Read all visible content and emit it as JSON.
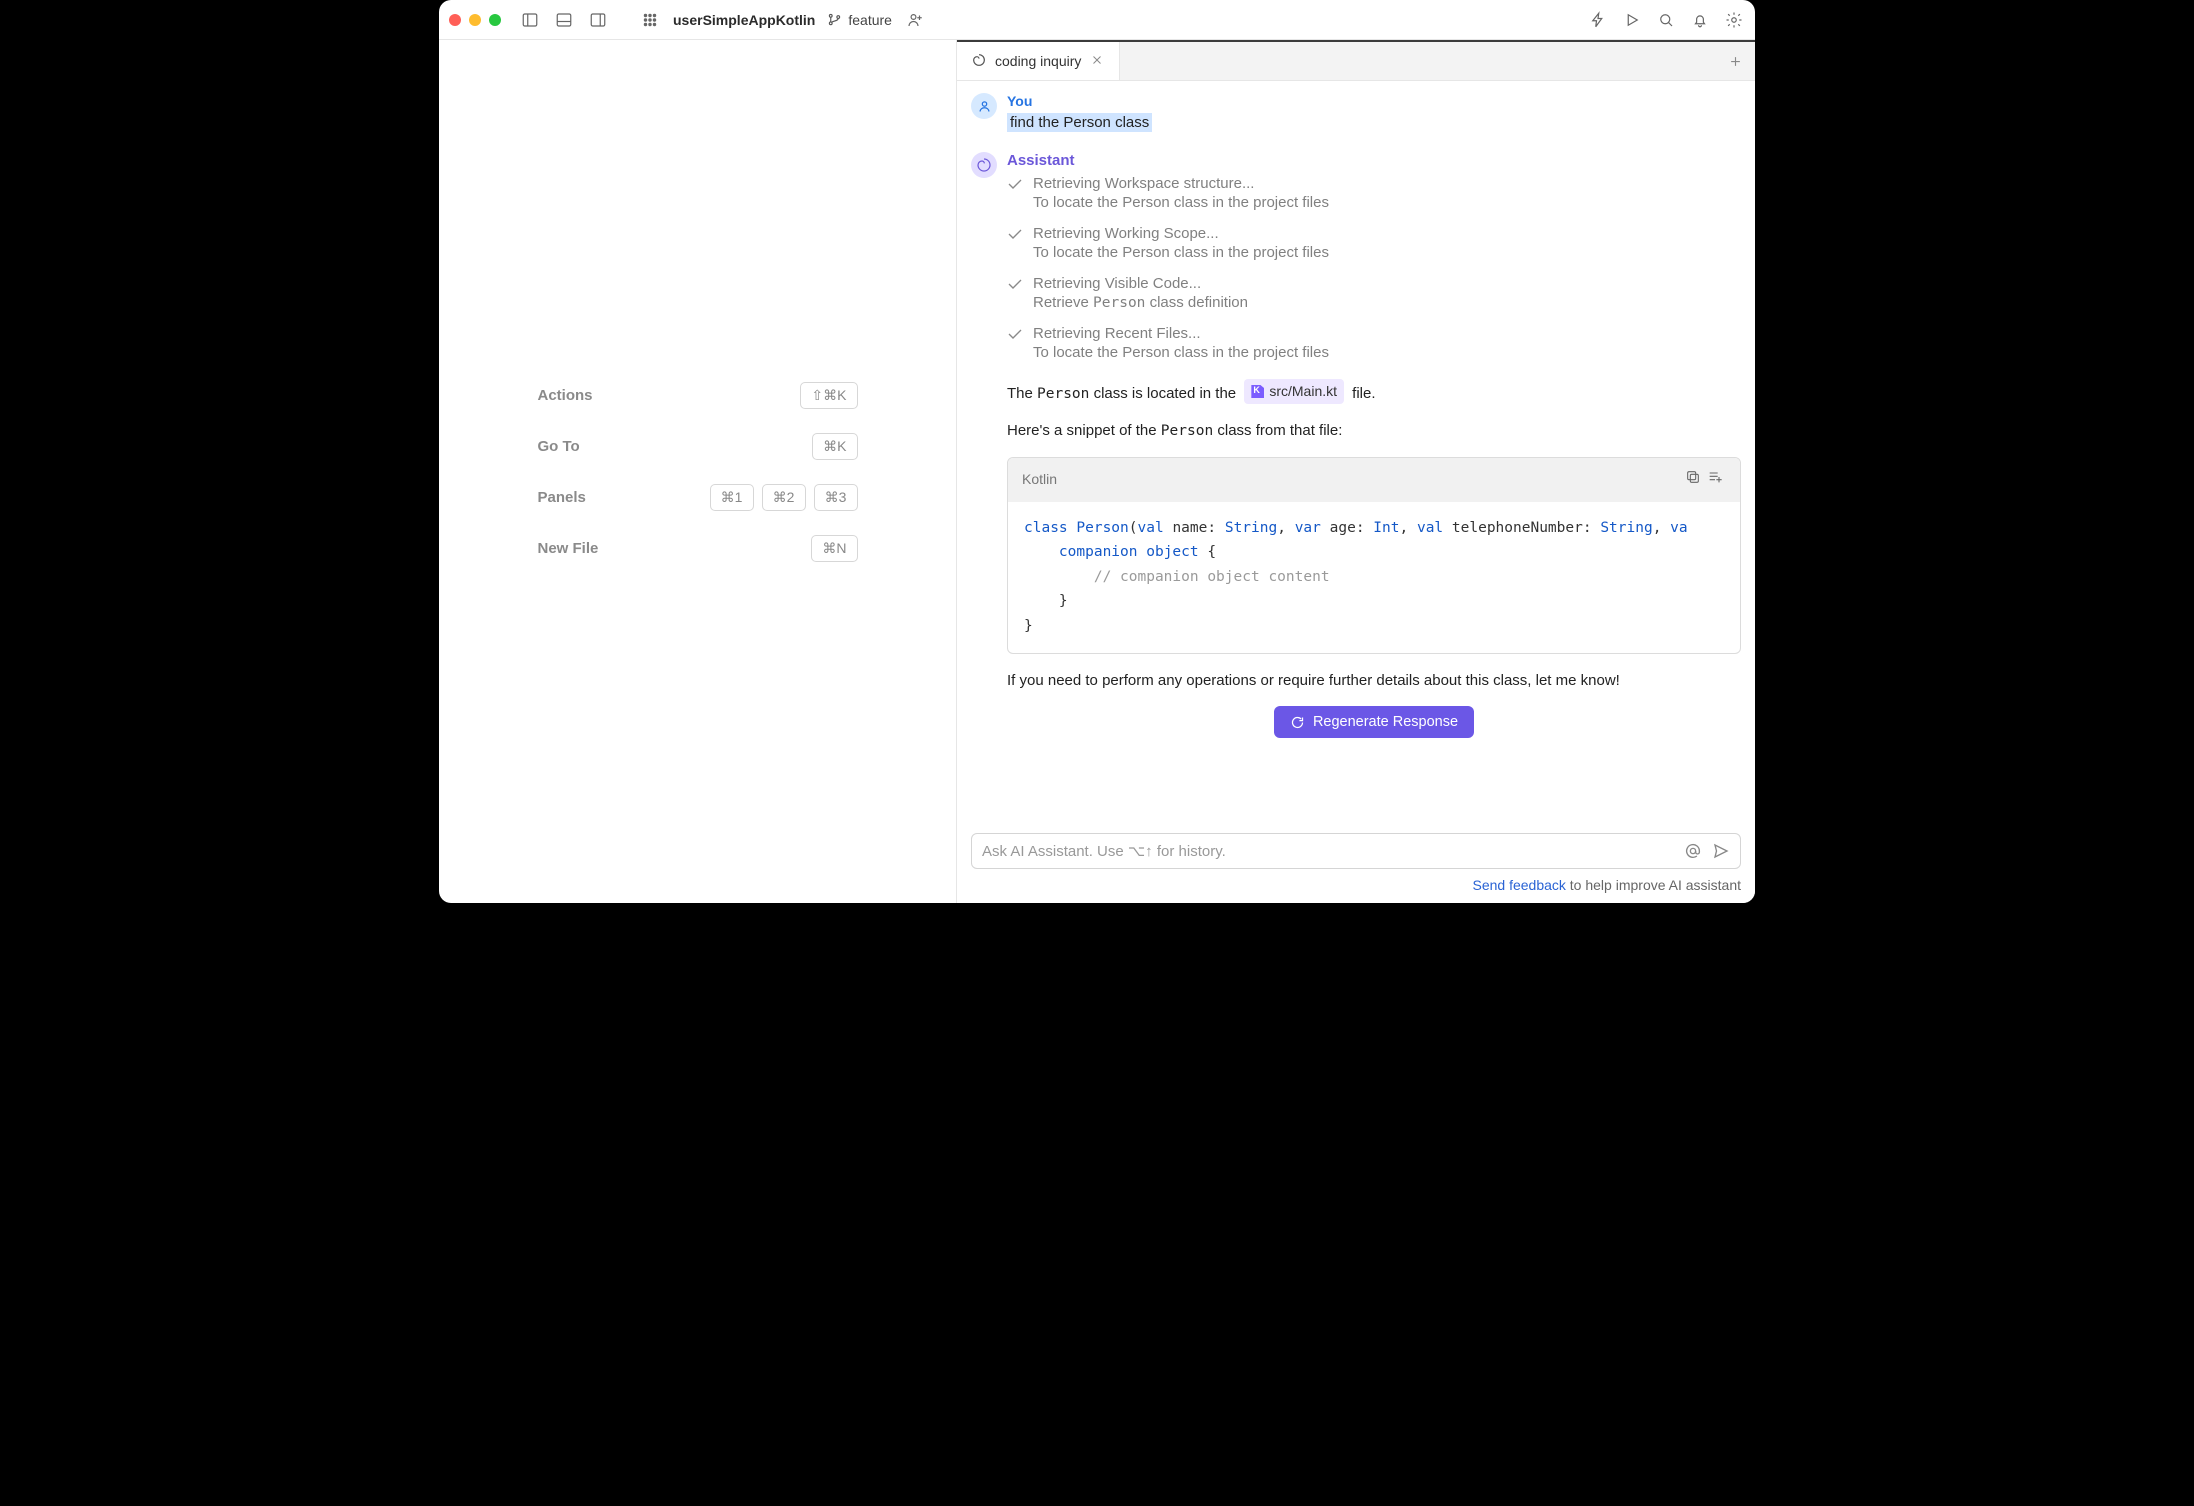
{
  "titlebar": {
    "project": "userSimpleAppKotlin",
    "branch": "feature"
  },
  "hints": {
    "actions": {
      "label": "Actions",
      "key": "⇧⌘K"
    },
    "goto": {
      "label": "Go To",
      "key": "⌘K"
    },
    "panels": {
      "label": "Panels",
      "keys": [
        "⌘1",
        "⌘2",
        "⌘3"
      ]
    },
    "newfile": {
      "label": "New File",
      "key": "⌘N"
    }
  },
  "tab": {
    "title": "coding inquiry"
  },
  "chat": {
    "user_label": "You",
    "user_text": "find the Person class",
    "assistant_label": "Assistant",
    "steps": [
      {
        "title": "Retrieving Workspace structure...",
        "desc": "To locate the Person class in the project files"
      },
      {
        "title": "Retrieving Working Scope...",
        "desc": "To locate the Person class in the project files"
      },
      {
        "title": "Retrieving Visible Code...",
        "desc_prefix": "Retrieve ",
        "desc_code": "Person",
        "desc_suffix": " class definition"
      },
      {
        "title": "Retrieving Recent Files...",
        "desc": "To locate the Person class in the project files"
      }
    ],
    "answer_1_prefix": "The ",
    "answer_1_code": "Person",
    "answer_1_mid": " class is located in the ",
    "answer_1_file": "src/Main.kt",
    "answer_1_suffix": " file.",
    "answer_2_prefix": "Here's a snippet of the ",
    "answer_2_code": "Person",
    "answer_2_suffix": " class from that file:",
    "code_lang": "Kotlin",
    "answer_3": "If you need to perform any operations or require further details about this class, let me know!"
  },
  "code": {
    "line1": {
      "kw1": "class",
      "name": "Person",
      "open": "(",
      "kw2": "val",
      "p1": "name: ",
      "t1": "String",
      "c1": ", ",
      "kw3": "var",
      "p2": "age: ",
      "t2": "Int",
      "c2": ", ",
      "kw4": "val",
      "p3": "telephoneNumber: ",
      "t3": "String",
      "c3": ", ",
      "kw5": "va"
    },
    "line2": {
      "kw1": "companion",
      "kw2": "object",
      "brace": "{"
    },
    "line3": {
      "comment": "// companion object content"
    },
    "line4": "}",
    "line5": "}"
  },
  "regen": "Regenerate Response",
  "input": {
    "placeholder": "Ask AI Assistant. Use ⌥↑ for history."
  },
  "feedback": {
    "link": "Send feedback",
    "rest": " to help improve AI assistant"
  }
}
